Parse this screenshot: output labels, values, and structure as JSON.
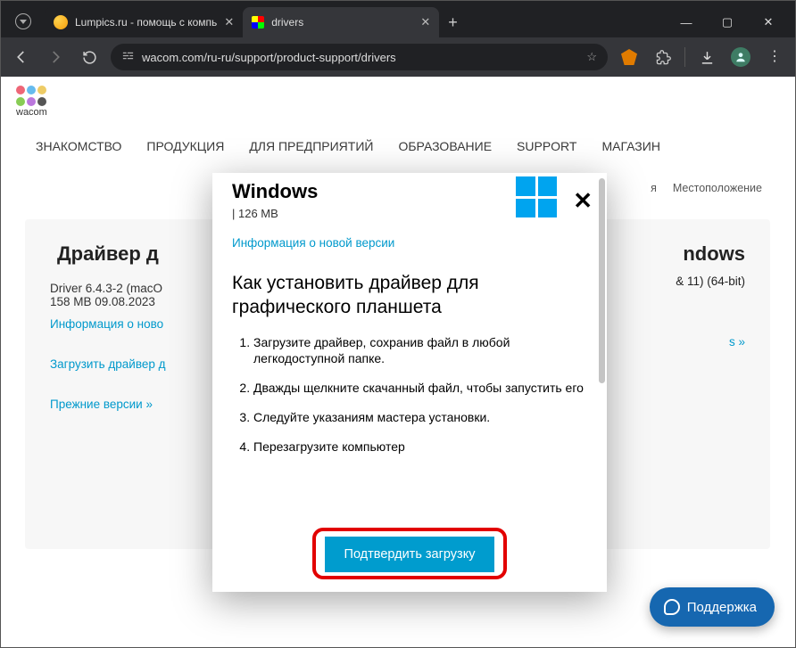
{
  "browser": {
    "tabs": [
      {
        "title": "Lumpics.ru - помощь с компь",
        "active": false
      },
      {
        "title": "drivers",
        "active": true
      }
    ],
    "url": "wacom.com/ru-ru/support/product-support/drivers",
    "window_controls": {
      "min": "—",
      "max": "▢",
      "close": "✕"
    }
  },
  "nav": {
    "items": [
      "ЗНАКОМСТВО",
      "ПРОДУКЦИЯ",
      "ДЛЯ ПРЕДПРИЯТИЙ",
      "ОБРАЗОВАНИЕ",
      "SUPPORT",
      "МАГАЗИН"
    ],
    "logo_text": "wacom",
    "subrow": {
      "lang_partial": "я",
      "loc": "Местоположение"
    }
  },
  "card": {
    "mac_title": "Драйвер д",
    "mac_meta_l1": "Driver 6.4.3-2 (macO",
    "mac_meta_l2": "158 MB 09.08.2023",
    "mac_info": "Информация о ново",
    "mac_download": "Загрузить драйвер д",
    "mac_prev": "Прежние версии »",
    "win_title_partial": "ndows",
    "win_meta_partial": "& 11) (64-bit)",
    "win_link_partial": "s »"
  },
  "modal": {
    "os": "Windows",
    "size": "| 126 MB",
    "info_link": "Информация о новой версии",
    "heading": "Как установить драйвер для графического планшета",
    "steps": [
      "Загрузите драйвер, сохранив файл в любой легкодоступной папке.",
      "Дважды щелкните скачанный файл, чтобы запустить его",
      "Следуйте указаниям мастера установки.",
      "Перезагрузите компьютер"
    ],
    "confirm": "Подтвердить загрузку"
  },
  "support_fab": "Поддержка",
  "colors": {
    "accent": "#009cce",
    "link": "#0099cc",
    "fab": "#1667b0",
    "highlight": "#e20000",
    "win_logo": "#00A4EF"
  }
}
